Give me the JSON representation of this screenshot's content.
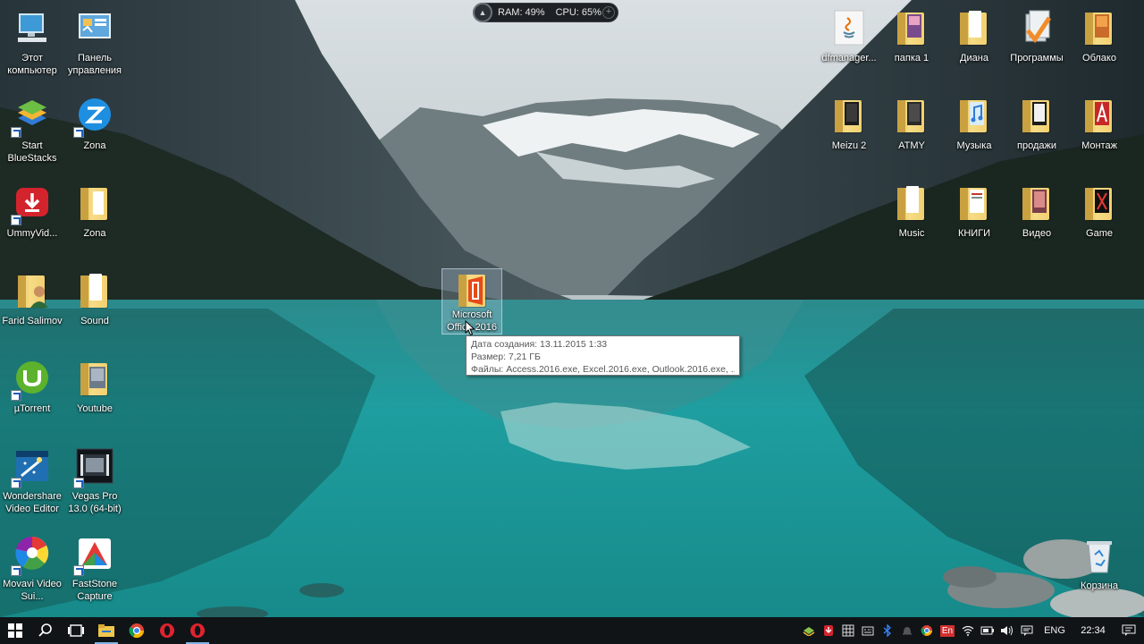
{
  "gadget": {
    "ram": "RAM: 49%",
    "cpu": "CPU: 65%"
  },
  "desktop": {
    "left_icons": [
      {
        "label": "Этот компьютер",
        "icon": "computer-icon"
      },
      {
        "label": "Панель управления",
        "icon": "control-panel-icon"
      },
      {
        "label": "Start BlueStacks",
        "icon": "bluestacks-icon"
      },
      {
        "label": "Zona",
        "icon": "zona-app-icon"
      },
      {
        "label": "UmmyVid...",
        "icon": "ummy-video-icon"
      },
      {
        "label": "Zona",
        "icon": "folder-icon"
      },
      {
        "label": "Farid Salimov",
        "icon": "user-folder-icon"
      },
      {
        "label": "Sound",
        "icon": "folder-icon"
      },
      {
        "label": "µTorrent",
        "icon": "utorrent-icon"
      },
      {
        "label": "Youtube",
        "icon": "folder-icon"
      },
      {
        "label": "Wondershare Video Editor",
        "icon": "wondershare-icon"
      },
      {
        "label": "Vegas Pro 13.0 (64-bit)",
        "icon": "vegas-icon"
      },
      {
        "label": "Movavi Video Sui...",
        "icon": "movavi-icon"
      },
      {
        "label": "FastStone Capture",
        "icon": "faststone-icon"
      }
    ],
    "right_icons": [
      {
        "label": "dfmanager...",
        "icon": "java-icon"
      },
      {
        "label": "папка 1",
        "icon": "folder-icon"
      },
      {
        "label": "Диана",
        "icon": "folder-icon"
      },
      {
        "label": "Программы",
        "icon": "programs-folder-icon"
      },
      {
        "label": "Облако",
        "icon": "folder-icon"
      },
      {
        "label": "Meizu 2",
        "icon": "folder-icon"
      },
      {
        "label": "ATMY",
        "icon": "folder-icon"
      },
      {
        "label": "Музыка",
        "icon": "folder-icon"
      },
      {
        "label": "продажи",
        "icon": "folder-icon"
      },
      {
        "label": "Монтаж",
        "icon": "folder-icon"
      },
      {
        "label": "Music",
        "icon": "folder-icon"
      },
      {
        "label": "КНИГИ",
        "icon": "folder-icon"
      },
      {
        "label": "Видео",
        "icon": "folder-icon"
      },
      {
        "label": "Game",
        "icon": "folder-icon"
      }
    ],
    "selected_icon": {
      "label": "Microsoft Office 2016",
      "icon": "office-folder-icon"
    },
    "recycle_bin": {
      "label": "Корзина",
      "icon": "recycle-bin-icon"
    }
  },
  "tooltip": {
    "created": "Дата создания: 13.11.2015 1:33",
    "size": "Размер: 7,21 ГБ",
    "files": "Файлы: Access.2016.exe, Excel.2016.exe, Outlook.2016.exe, ..."
  },
  "taskbar": {
    "language": "ENG",
    "time": "22:34",
    "input_indicator": "En"
  },
  "colors": {
    "taskbar_bg": "#101417",
    "folder": "#f1d070",
    "accent": "#7fb4e6"
  }
}
